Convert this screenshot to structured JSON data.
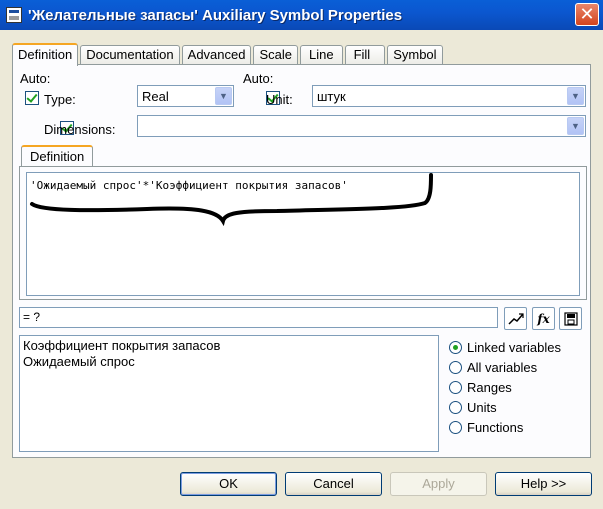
{
  "window": {
    "title": "'Желательные запасы' Auxiliary Symbol Properties",
    "close_symbol": "✕"
  },
  "tabs": [
    {
      "label": "Definition",
      "active": true
    },
    {
      "label": "Documentation",
      "active": false
    },
    {
      "label": "Advanced",
      "active": false
    },
    {
      "label": "Scale",
      "active": false
    },
    {
      "label": "Line",
      "active": false
    },
    {
      "label": "Fill",
      "active": false
    },
    {
      "label": "Symbol",
      "active": false
    }
  ],
  "form": {
    "auto_label_1": "Auto:",
    "auto_label_2": "Auto:",
    "type_label": "Type:",
    "type_value": "Real",
    "unit_label": "Unit:",
    "unit_value": "штук",
    "dimensions_label": "Dimensions:",
    "dimensions_value": "",
    "type_checked": true,
    "unit_checked": true,
    "dimensions_checked": true
  },
  "definition": {
    "tab_label": "Definition",
    "equation": "'Ожидаемый спрос'*'Коэффициент покрытия запасов'",
    "result": "= ?"
  },
  "toolbar": {
    "graph_icon": "trend-icon",
    "function_icon": "fx-icon",
    "save_icon": "save-icon",
    "fx_text": "fx"
  },
  "variables": {
    "items": [
      "Коэффициент покрытия запасов",
      "Ожидаемый спрос"
    ]
  },
  "filter_options": [
    {
      "label": "Linked variables",
      "selected": true
    },
    {
      "label": "All variables",
      "selected": false
    },
    {
      "label": "Ranges",
      "selected": false
    },
    {
      "label": "Units",
      "selected": false
    },
    {
      "label": "Functions",
      "selected": false
    }
  ],
  "buttons": {
    "ok": "OK",
    "cancel": "Cancel",
    "apply": "Apply",
    "help": "Help >>"
  },
  "colors": {
    "titlebar": "#0a5fd6",
    "tab_highlight": "#f5a623",
    "check_green": "#21a121",
    "annotation_ink": "#000000"
  }
}
